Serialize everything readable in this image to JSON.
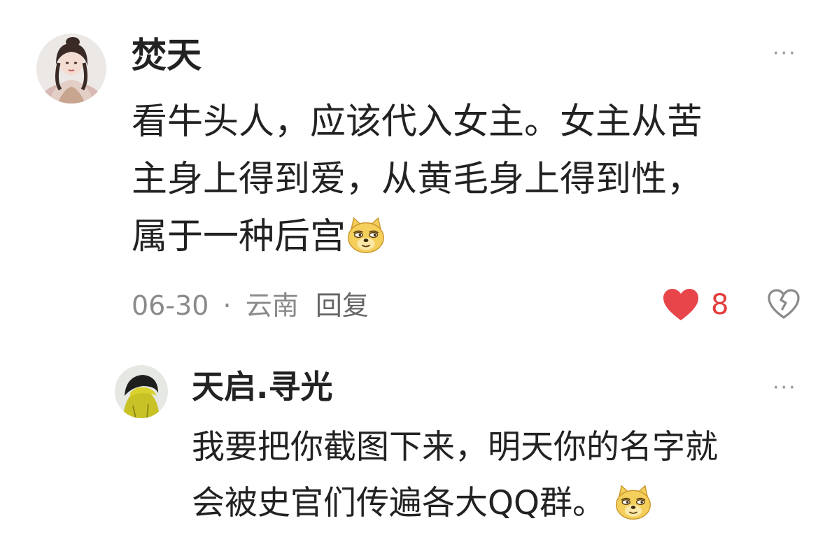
{
  "comment": {
    "username": "焚天",
    "text_lines": [
      "看牛头人，应该代入女主。女主从苦",
      "主身上得到爱，从黄毛身上得到性，",
      "属于一种后宫"
    ],
    "trailing_emoji": "doge-emoji",
    "date": "06-30",
    "separator": "·",
    "location": "云南",
    "reply_label": "回复",
    "like_count": "8",
    "more_label": "···"
  },
  "reply": {
    "username": "天启.寻光",
    "text_lines": [
      "我要把你截图下来，明天你的名字就",
      "会被史官们传遍各大QQ群。"
    ],
    "trailing_emoji": "doge-emoji",
    "more_label": "···"
  },
  "colors": {
    "like_heart": "#e8454a",
    "like_count": "#e23d3d",
    "meta_text": "#8a8a8a",
    "emoji_face": "#f4cf5b"
  }
}
